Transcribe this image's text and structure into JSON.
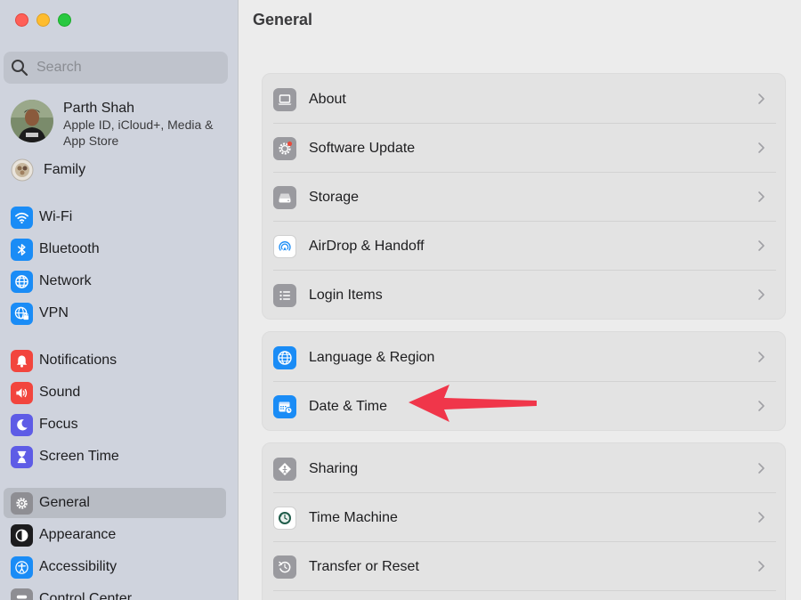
{
  "window": {
    "title": "General"
  },
  "sidebar": {
    "search_placeholder": "Search",
    "account": {
      "name": "Parth Shah",
      "subtitle": "Apple ID, iCloud+, Media & App Store"
    },
    "family_label": "Family",
    "items": [
      {
        "label": "Wi-Fi",
        "icon": "wifi-icon",
        "color": "#1a8cf6"
      },
      {
        "label": "Bluetooth",
        "icon": "bluetooth-icon",
        "color": "#1a8cf6"
      },
      {
        "label": "Network",
        "icon": "globe-icon",
        "color": "#1a8cf6"
      },
      {
        "label": "VPN",
        "icon": "vpn-globe-icon",
        "color": "#1a8cf6"
      },
      {
        "label": "Notifications",
        "icon": "bell-icon",
        "color": "#f2453d"
      },
      {
        "label": "Sound",
        "icon": "speaker-icon",
        "color": "#f2453d"
      },
      {
        "label": "Focus",
        "icon": "moon-icon",
        "color": "#5e5ce6"
      },
      {
        "label": "Screen Time",
        "icon": "hourglass-icon",
        "color": "#5e5ce6"
      },
      {
        "label": "General",
        "icon": "gear-icon",
        "color": "#8e8e93",
        "selected": true
      },
      {
        "label": "Appearance",
        "icon": "appearance-icon",
        "color": "#1c1c1e"
      },
      {
        "label": "Accessibility",
        "icon": "accessibility-icon",
        "color": "#1a8cf6"
      },
      {
        "label": "Control Center",
        "icon": "control-center-icon",
        "color": "#8e8e93"
      }
    ]
  },
  "main": {
    "groups": [
      {
        "rows": [
          {
            "label": "About",
            "icon": "laptop-icon"
          },
          {
            "label": "Software Update",
            "icon": "gear-badge-icon"
          },
          {
            "label": "Storage",
            "icon": "drive-icon"
          },
          {
            "label": "AirDrop & Handoff",
            "icon": "airdrop-icon"
          },
          {
            "label": "Login Items",
            "icon": "list-icon"
          }
        ]
      },
      {
        "rows": [
          {
            "label": "Language & Region",
            "icon": "globe-icon"
          },
          {
            "label": "Date & Time",
            "icon": "calendar-clock-icon"
          }
        ]
      },
      {
        "rows": [
          {
            "label": "Sharing",
            "icon": "sharing-icon"
          },
          {
            "label": "Time Machine",
            "icon": "time-machine-icon"
          },
          {
            "label": "Transfer or Reset",
            "icon": "reset-icon"
          }
        ]
      }
    ]
  },
  "annotation": {
    "arrow_color": "#f0364a",
    "points_to": "Date & Time"
  }
}
